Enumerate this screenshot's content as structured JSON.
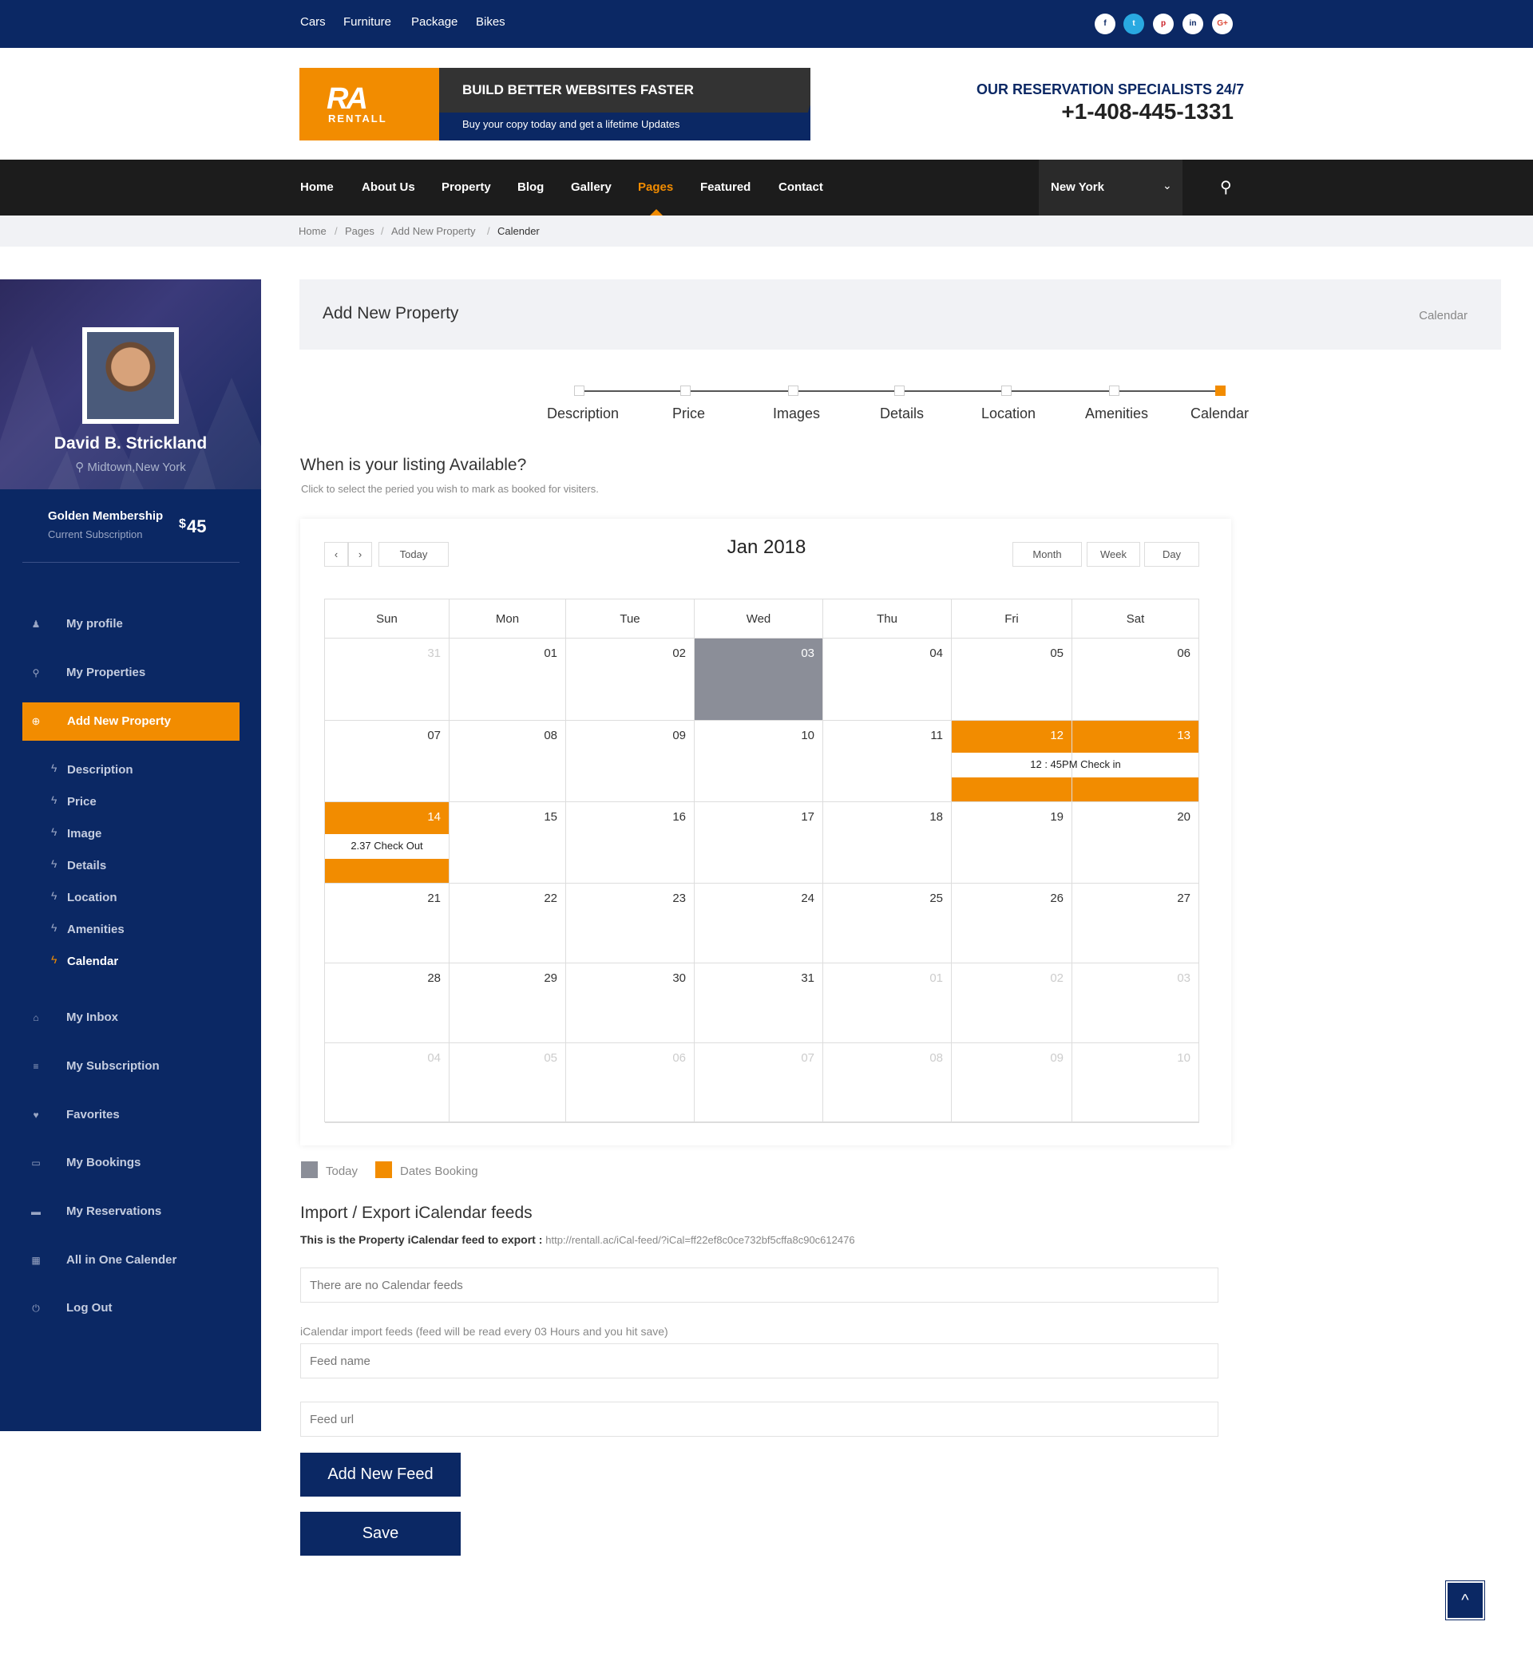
{
  "topbar": {
    "links": [
      "Cars",
      "Furniture",
      "Package",
      "Bikes"
    ],
    "social": [
      {
        "name": "facebook-icon",
        "glyph": "f"
      },
      {
        "name": "twitter-icon",
        "glyph": "t"
      },
      {
        "name": "pinterest-icon",
        "glyph": "p"
      },
      {
        "name": "linkedin-icon",
        "glyph": "in"
      },
      {
        "name": "google-plus-icon",
        "glyph": "G+"
      }
    ]
  },
  "banner": {
    "logo": "RA",
    "logo_sub": "RENTALL",
    "headline": "BUILD BETTER WEBSITES FASTER",
    "subline": "Buy your copy today and get a lifetime Updates"
  },
  "contact": {
    "label": "OUR RESERVATION SPECIALISTS 24/7",
    "phone": "+1-408-445-1331"
  },
  "nav": {
    "items": [
      "Home",
      "About Us",
      "Property",
      "Blog",
      "Gallery",
      "Pages",
      "Featured",
      "Contact"
    ],
    "active": "Pages",
    "city": "New York"
  },
  "breadcrumb": [
    "Home",
    "Pages",
    "Add New Property",
    "Calender"
  ],
  "profile": {
    "name": "David B. Strickland",
    "location": "Midtown,New York",
    "membership": "Golden Membership",
    "subscription_label": "Current Subscription",
    "currency": "$",
    "price": "45"
  },
  "sidebar": {
    "items": [
      {
        "label": "My profile",
        "icon": "user-icon",
        "glyph": "♟"
      },
      {
        "label": "My Properties",
        "icon": "map-pin-icon",
        "glyph": "⚲"
      },
      {
        "label": "Add New Property",
        "icon": "plus-circle-icon",
        "glyph": "⊕"
      }
    ],
    "subitems": [
      "Description",
      "Price",
      "Image",
      "Details",
      "Location",
      "Amenities",
      "Calendar"
    ],
    "items2": [
      {
        "label": "My Inbox",
        "icon": "inbox-icon",
        "glyph": "⌂"
      },
      {
        "label": "My Subscription",
        "icon": "list-icon",
        "glyph": "≡"
      },
      {
        "label": "Favorites",
        "icon": "heart-icon",
        "glyph": "♥"
      },
      {
        "label": "My Bookings",
        "icon": "folder-open-icon",
        "glyph": "▭"
      },
      {
        "label": "My Reservations",
        "icon": "folder-icon",
        "glyph": "▬"
      },
      {
        "label": "All in One Calender",
        "icon": "calendar-icon",
        "glyph": "▦"
      },
      {
        "label": "Log Out",
        "icon": "power-icon",
        "glyph": "⏻"
      }
    ]
  },
  "page_header": {
    "title": "Add New Property",
    "right": "Calendar"
  },
  "steps": [
    "Description",
    "Price",
    "Images",
    "Details",
    "Location",
    "Amenities",
    "Calendar"
  ],
  "availability": {
    "title": "When is your listing Available?",
    "hint": "Click to select the peried you wish to mark as booked for visiters."
  },
  "calendar": {
    "month": "Jan 2018",
    "today_btn": "Today",
    "views": [
      "Month",
      "Week",
      "Day"
    ],
    "weekdays": [
      "Sun",
      "Mon",
      "Tue",
      "Wed",
      "Thu",
      "Fri",
      "Sat"
    ],
    "weeks": [
      [
        "31",
        "01",
        "02",
        "03",
        "04",
        "05",
        "06"
      ],
      [
        "07",
        "08",
        "09",
        "10",
        "11",
        "12",
        "13"
      ],
      [
        "14",
        "15",
        "16",
        "17",
        "18",
        "19",
        "20"
      ],
      [
        "21",
        "22",
        "23",
        "24",
        "25",
        "26",
        "27"
      ],
      [
        "28",
        "29",
        "30",
        "31",
        "01",
        "02",
        "03"
      ],
      [
        "04",
        "05",
        "06",
        "07",
        "08",
        "09",
        "10"
      ]
    ],
    "events": {
      "checkin": "12 : 45PM Check in",
      "checkout": "2.37 Check Out"
    },
    "today_color": "#8b8e98",
    "booking_color": "#f28c00"
  },
  "legend": {
    "today": "Today",
    "booking": "Dates Booking"
  },
  "ical": {
    "title": "Import / Export iCalendar feeds",
    "export_label": "This is the Property iCalendar feed to export :",
    "export_url": "http://rentall.ac/iCal-feed/?iCal=ff22ef8c0ce732bf5cffa8c90c612476",
    "no_feeds": "There are no Calendar feeds",
    "import_hint": "iCalendar import feeds (feed will be read every 03 Hours and you hit save)",
    "feed_name_ph": "Feed name",
    "feed_url_ph": "Feed url",
    "add_btn": "Add New Feed",
    "save_btn": "Save"
  },
  "colors": {
    "primary": "#0b2864",
    "accent": "#f28c00",
    "dark": "#1c1c1c"
  }
}
